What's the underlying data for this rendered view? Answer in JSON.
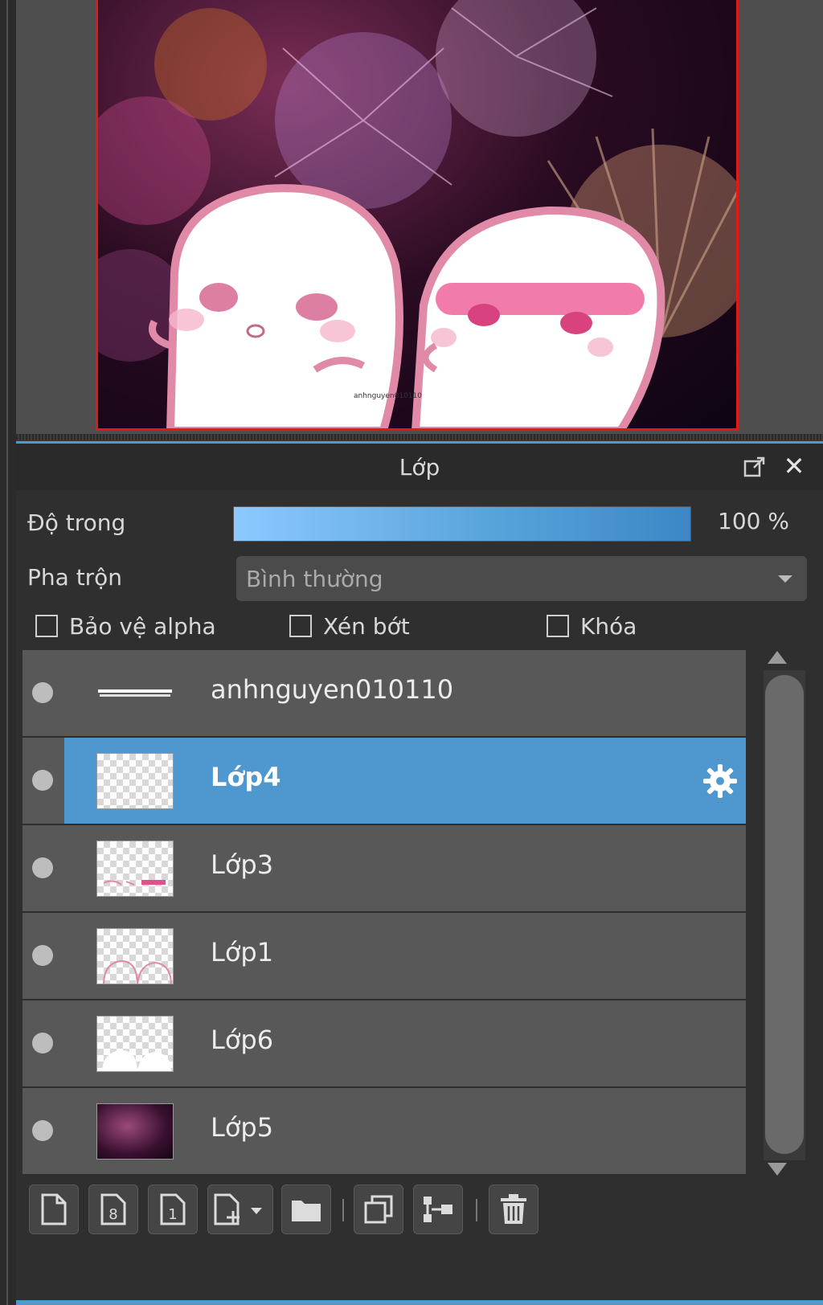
{
  "panel": {
    "title": "Lớp",
    "opacity_label": "Độ trong",
    "opacity_percent": 100,
    "opacity_value": "100 %",
    "blend_label": "Pha trộn",
    "blend_value": "Bình thường",
    "checkboxes": [
      {
        "label": "Bảo vệ alpha",
        "checked": false
      },
      {
        "label": "Xén bớt",
        "checked": false
      },
      {
        "label": "Khóa",
        "checked": false
      }
    ]
  },
  "layers": [
    {
      "name": "anhnguyen010110",
      "selected": false,
      "thumb": "text"
    },
    {
      "name": "Lớp4",
      "selected": true,
      "thumb": "empty"
    },
    {
      "name": "Lớp3",
      "selected": false,
      "thumb": "pink-strokes"
    },
    {
      "name": "Lớp1",
      "selected": false,
      "thumb": "outline"
    },
    {
      "name": "Lớp6",
      "selected": false,
      "thumb": "white-fill"
    },
    {
      "name": "Lớp5",
      "selected": false,
      "thumb": "fireworks-photo"
    }
  ],
  "toolbar": {
    "icons": [
      "new-layer-icon",
      "8bit-layer-icon",
      "1bit-layer-icon",
      "add-layer-dropdown-icon",
      "folder-icon",
      "duplicate-icon",
      "merge-down-icon",
      "trash-icon"
    ]
  },
  "colors": {
    "selection": "#4e97cf",
    "accent_blue": "#4a9ad0",
    "canvas_border": "#e01818"
  }
}
